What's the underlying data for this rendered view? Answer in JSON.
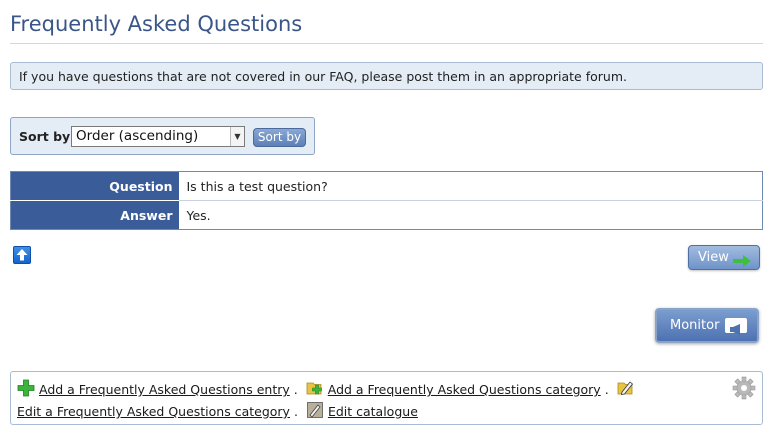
{
  "page": {
    "title": "Frequently Asked Questions"
  },
  "info": {
    "text": "If you have questions that are not covered in our FAQ, please post them in an appropriate forum."
  },
  "sort": {
    "label": "Sort by:",
    "selected": "Order (ascending)",
    "button_label": "Sort by"
  },
  "faq": {
    "rows": [
      {
        "label": "Question",
        "value": "Is this a test question?"
      },
      {
        "label": "Answer",
        "value": "Yes."
      }
    ]
  },
  "buttons": {
    "view_label": "View",
    "monitor_label": "Monitor"
  },
  "actions": {
    "add_entry": "Add a Frequently Asked Questions entry",
    "add_category": "Add a Frequently Asked Questions category",
    "edit_category": "Edit a Frequently Asked Questions category",
    "edit_catalogue": "Edit catalogue",
    "separator": "."
  },
  "icons": {
    "back_to_top": "arrow-up-icon",
    "view": "go-arrow-icon",
    "monitor": "megaphone-icon",
    "add_entry": "plus-icon",
    "add_category": "folder-add-icon",
    "edit": "edit-pencil-icon",
    "catalogue": "catalogue-icon",
    "settings": "gear-icon"
  },
  "colors": {
    "title": "#3a5689",
    "table_header": "#3a5d9a",
    "button": "#6f93c8",
    "info_bg": "#e4ecf5"
  }
}
